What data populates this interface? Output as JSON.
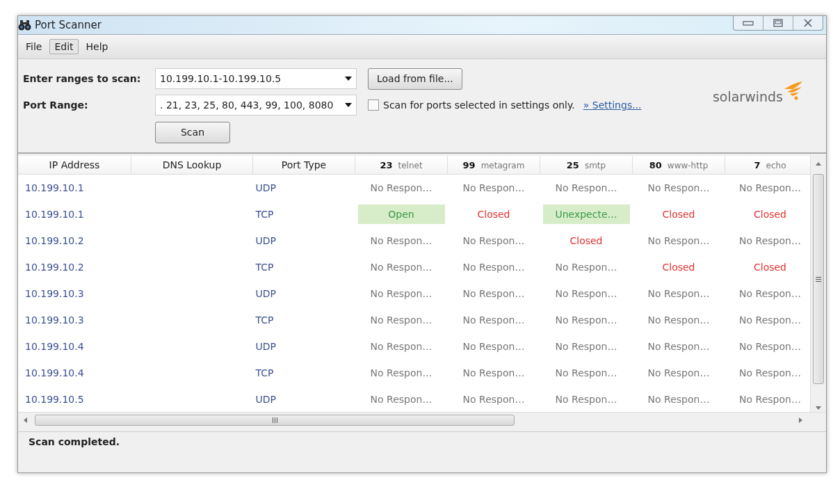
{
  "window": {
    "title": "Port Scanner"
  },
  "menu": [
    {
      "label": "File",
      "selected": false
    },
    {
      "label": "Edit",
      "selected": true
    },
    {
      "label": "Help",
      "selected": false
    }
  ],
  "form": {
    "ranges_label": "Enter ranges to scan:",
    "ranges_value": "10.199.10.1-10.199.10.5",
    "load_button": "Load from file...",
    "port_label": "Port Range:",
    "port_value": ". 21, 23, 25, 80, 443, 99, 100, 8080",
    "settings_only": {
      "label": "Scan for ports selected in settings only.",
      "checked": false
    },
    "settings_link": "» Settings...",
    "scan_button": "Scan"
  },
  "logo": {
    "text": "solarwinds"
  },
  "table": {
    "columns": [
      {
        "label": "IP Address"
      },
      {
        "label": "DNS Lookup"
      },
      {
        "label": "Port Type"
      },
      {
        "port": "23",
        "service": "telnet"
      },
      {
        "port": "99",
        "service": "metagram"
      },
      {
        "port": "25",
        "service": "smtp"
      },
      {
        "port": "80",
        "service": "www-http"
      },
      {
        "port": "7",
        "service": "echo"
      }
    ],
    "rows": [
      {
        "cells": [
          {
            "text": "10.199.10.1",
            "kind": "ip"
          },
          {
            "text": "",
            "kind": "empty"
          },
          {
            "text": "UDP",
            "kind": "type"
          },
          {
            "text": "No Respon…",
            "kind": "none"
          },
          {
            "text": "No Respon…",
            "kind": "none"
          },
          {
            "text": "No Respon…",
            "kind": "none"
          },
          {
            "text": "No Respon…",
            "kind": "none"
          },
          {
            "text": "No Respon…",
            "kind": "none"
          }
        ]
      },
      {
        "cells": [
          {
            "text": "10.199.10.1",
            "kind": "ip"
          },
          {
            "text": "",
            "kind": "empty"
          },
          {
            "text": "TCP",
            "kind": "type"
          },
          {
            "text": "Open",
            "kind": "open"
          },
          {
            "text": "Closed",
            "kind": "closed"
          },
          {
            "text": "Unexpecte…",
            "kind": "open"
          },
          {
            "text": "Closed",
            "kind": "closed"
          },
          {
            "text": "Closed",
            "kind": "closed"
          }
        ]
      },
      {
        "cells": [
          {
            "text": "10.199.10.2",
            "kind": "ip"
          },
          {
            "text": "",
            "kind": "empty"
          },
          {
            "text": "UDP",
            "kind": "type"
          },
          {
            "text": "No Respon…",
            "kind": "none"
          },
          {
            "text": "No Respon…",
            "kind": "none"
          },
          {
            "text": "Closed",
            "kind": "closed"
          },
          {
            "text": "No Respon…",
            "kind": "none"
          },
          {
            "text": "No Respon…",
            "kind": "none"
          }
        ]
      },
      {
        "cells": [
          {
            "text": "10.199.10.2",
            "kind": "ip"
          },
          {
            "text": "",
            "kind": "empty"
          },
          {
            "text": "TCP",
            "kind": "type"
          },
          {
            "text": "No Respon…",
            "kind": "none"
          },
          {
            "text": "No Respon…",
            "kind": "none"
          },
          {
            "text": "No Respon…",
            "kind": "none"
          },
          {
            "text": "Closed",
            "kind": "closed"
          },
          {
            "text": "Closed",
            "kind": "closed"
          }
        ]
      },
      {
        "cells": [
          {
            "text": "10.199.10.3",
            "kind": "ip"
          },
          {
            "text": "",
            "kind": "empty"
          },
          {
            "text": "UDP",
            "kind": "type"
          },
          {
            "text": "No Respon…",
            "kind": "none"
          },
          {
            "text": "No Respon…",
            "kind": "none"
          },
          {
            "text": "No Respon…",
            "kind": "none"
          },
          {
            "text": "No Respon…",
            "kind": "none"
          },
          {
            "text": "No Respon…",
            "kind": "none"
          }
        ]
      },
      {
        "cells": [
          {
            "text": "10.199.10.3",
            "kind": "ip"
          },
          {
            "text": "",
            "kind": "empty"
          },
          {
            "text": "TCP",
            "kind": "type"
          },
          {
            "text": "No Respon…",
            "kind": "none"
          },
          {
            "text": "No Respon…",
            "kind": "none"
          },
          {
            "text": "No Respon…",
            "kind": "none"
          },
          {
            "text": "No Respon…",
            "kind": "none"
          },
          {
            "text": "No Respon…",
            "kind": "none"
          }
        ]
      },
      {
        "cells": [
          {
            "text": "10.199.10.4",
            "kind": "ip"
          },
          {
            "text": "",
            "kind": "empty"
          },
          {
            "text": "UDP",
            "kind": "type"
          },
          {
            "text": "No Respon…",
            "kind": "none"
          },
          {
            "text": "No Respon…",
            "kind": "none"
          },
          {
            "text": "No Respon…",
            "kind": "none"
          },
          {
            "text": "No Respon…",
            "kind": "none"
          },
          {
            "text": "No Respon…",
            "kind": "none"
          }
        ]
      },
      {
        "cells": [
          {
            "text": "10.199.10.4",
            "kind": "ip"
          },
          {
            "text": "",
            "kind": "empty"
          },
          {
            "text": "TCP",
            "kind": "type"
          },
          {
            "text": "No Respon…",
            "kind": "none"
          },
          {
            "text": "No Respon…",
            "kind": "none"
          },
          {
            "text": "No Respon…",
            "kind": "none"
          },
          {
            "text": "No Respon…",
            "kind": "none"
          },
          {
            "text": "No Respon…",
            "kind": "none"
          }
        ]
      },
      {
        "cells": [
          {
            "text": "10.199.10.5",
            "kind": "ip"
          },
          {
            "text": "",
            "kind": "empty"
          },
          {
            "text": "UDP",
            "kind": "type"
          },
          {
            "text": "No Respon…",
            "kind": "none"
          },
          {
            "text": "No Respon…",
            "kind": "none"
          },
          {
            "text": "No Respon…",
            "kind": "none"
          },
          {
            "text": "No Respon…",
            "kind": "none"
          },
          {
            "text": "No Respon…",
            "kind": "none"
          }
        ]
      }
    ]
  },
  "status_bar": {
    "text": "Scan completed."
  }
}
